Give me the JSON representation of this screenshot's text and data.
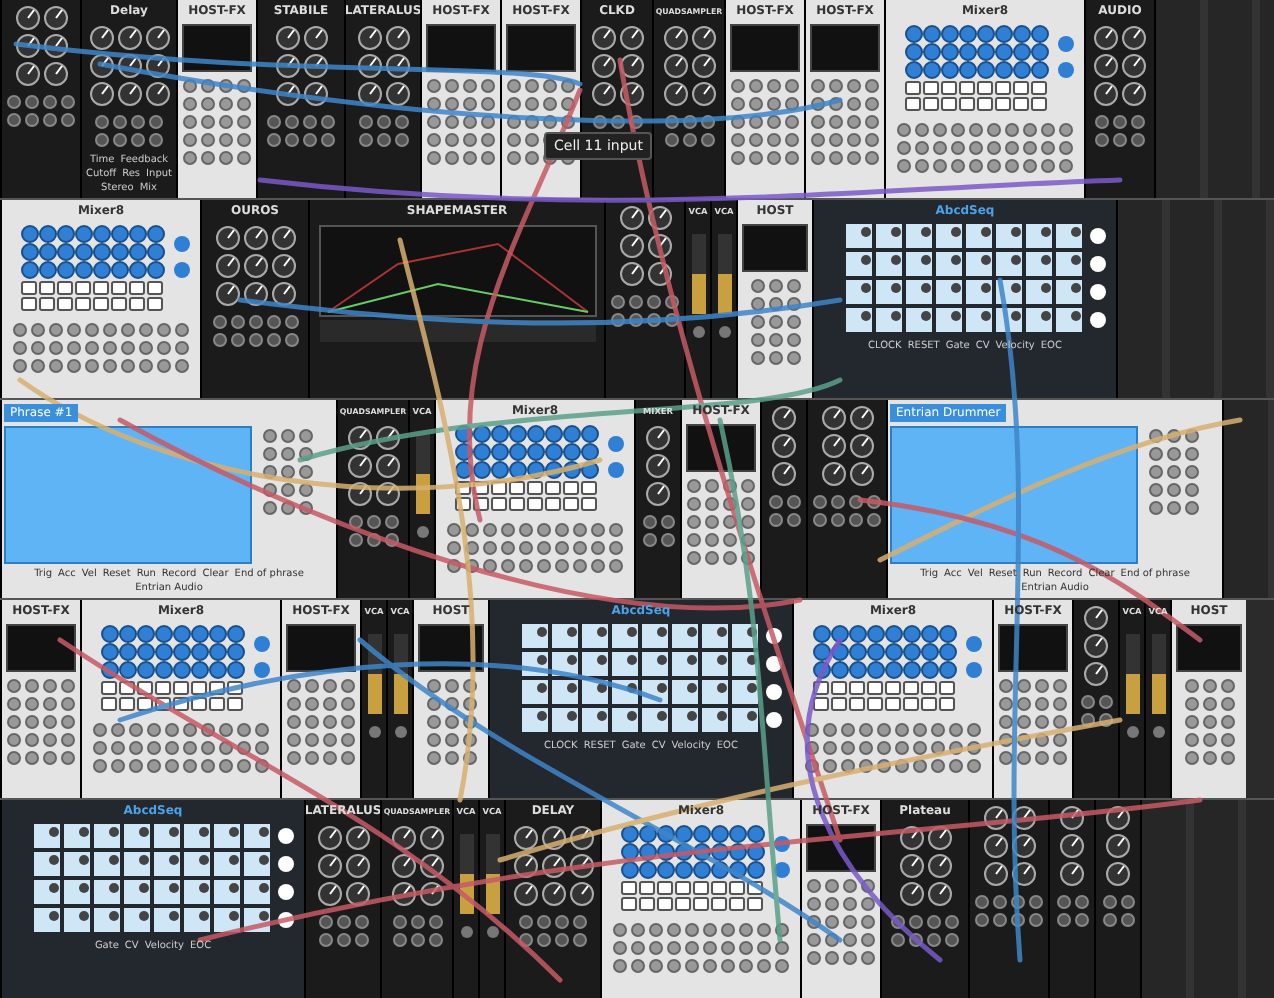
{
  "tooltip": "Cell 11 input",
  "rows": [
    {
      "modules": [
        {
          "kind": "misc"
        },
        {
          "kind": "delay",
          "title": "Delay",
          "labels": [
            "Time",
            "Feedback",
            "Cutoff",
            "Res",
            "Input",
            "Stereo",
            "Mix"
          ]
        },
        {
          "kind": "host-fx",
          "title": "HOST-FX"
        },
        {
          "kind": "stabile",
          "title": "STABILE"
        },
        {
          "kind": "lateralus",
          "title": "LATERALUS"
        },
        {
          "kind": "host-fx",
          "title": "HOST-FX"
        },
        {
          "kind": "host-fx",
          "title": "HOST-FX"
        },
        {
          "kind": "clkd",
          "title": "CLKD"
        },
        {
          "kind": "quadsampler",
          "title": "QUADSAMPLER"
        },
        {
          "kind": "host-fx",
          "title": "HOST-FX"
        },
        {
          "kind": "host-fx",
          "title": "HOST-FX"
        },
        {
          "kind": "mixer",
          "title": "Mixer8"
        },
        {
          "kind": "audio",
          "title": "AUDIO"
        },
        {
          "kind": "blank"
        }
      ]
    },
    {
      "modules": [
        {
          "kind": "mixer",
          "title": "Mixer8"
        },
        {
          "kind": "ouros",
          "title": "OUROS"
        },
        {
          "kind": "shapemaster",
          "title": "SHAPEMASTER"
        },
        {
          "kind": "misc"
        },
        {
          "kind": "vca",
          "title": "VCA"
        },
        {
          "kind": "vca",
          "title": "VCA"
        },
        {
          "kind": "host",
          "title": "HOST"
        },
        {
          "kind": "abcdseq",
          "title": "AbcdSeq",
          "labels": [
            "CLOCK",
            "RESET",
            "Gate",
            "CV",
            "Velocity",
            "EOC"
          ]
        },
        {
          "kind": "blank"
        }
      ]
    },
    {
      "modules": [
        {
          "kind": "entrian",
          "title": "Phrase #1",
          "labels": [
            "Trig",
            "Acc",
            "Vel",
            "Reset",
            "Run",
            "Record",
            "Clear",
            "End of phrase",
            "Entrian Audio"
          ]
        },
        {
          "kind": "quadsampler",
          "title": "QUADSAMPLER"
        },
        {
          "kind": "vca",
          "title": "VCA"
        },
        {
          "kind": "mixer",
          "title": "Mixer8"
        },
        {
          "kind": "narrow",
          "title": "MIXER"
        },
        {
          "kind": "host-fx",
          "title": "HOST-FX"
        },
        {
          "kind": "narrow"
        },
        {
          "kind": "misc"
        },
        {
          "kind": "entrian",
          "title": "Entrian Drummer",
          "labels": [
            "Trig",
            "Acc",
            "Vel",
            "Reset",
            "Run",
            "Record",
            "Clear",
            "End of phrase",
            "Entrian Audio"
          ]
        },
        {
          "kind": "blank"
        }
      ]
    },
    {
      "modules": [
        {
          "kind": "host-fx",
          "title": "HOST-FX"
        },
        {
          "kind": "mixer",
          "title": "Mixer8"
        },
        {
          "kind": "host-fx",
          "title": "HOST-FX"
        },
        {
          "kind": "vca",
          "title": "VCA"
        },
        {
          "kind": "vca",
          "title": "VCA"
        },
        {
          "kind": "host",
          "title": "HOST"
        },
        {
          "kind": "abcdseq",
          "title": "AbcdSeq",
          "labels": [
            "CLOCK",
            "RESET",
            "Gate",
            "CV",
            "Velocity",
            "EOC"
          ]
        },
        {
          "kind": "mixer",
          "title": "Mixer8"
        },
        {
          "kind": "host-fx",
          "title": "HOST-FX"
        },
        {
          "kind": "narrow"
        },
        {
          "kind": "vca",
          "title": "VCA"
        },
        {
          "kind": "vca",
          "title": "VCA"
        },
        {
          "kind": "host",
          "title": "HOST"
        }
      ]
    },
    {
      "modules": [
        {
          "kind": "abcdseq",
          "title": "AbcdSeq",
          "labels": [
            "Gate",
            "CV",
            "Velocity",
            "EOC"
          ]
        },
        {
          "kind": "lateralus",
          "title": "LATERALUS"
        },
        {
          "kind": "quadsampler",
          "title": "QUADSAMPLER"
        },
        {
          "kind": "vca",
          "title": "VCA"
        },
        {
          "kind": "vca",
          "title": "VCA"
        },
        {
          "kind": "delay",
          "title": "DELAY"
        },
        {
          "kind": "mixer",
          "title": "Mixer8"
        },
        {
          "kind": "host-fx",
          "title": "HOST-FX"
        },
        {
          "kind": "valley",
          "title": "Plateau"
        },
        {
          "kind": "misc"
        },
        {
          "kind": "narrow"
        },
        {
          "kind": "narrow"
        },
        {
          "kind": "blank"
        }
      ]
    }
  ]
}
